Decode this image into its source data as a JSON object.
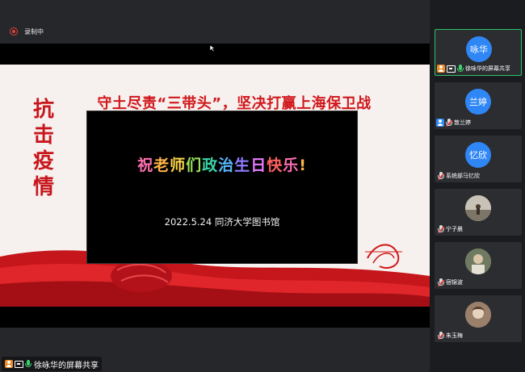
{
  "recording": {
    "label": "录制中"
  },
  "slide": {
    "banner": "守土尽责“三带头”，坚决打赢上海保卫战",
    "vertical_title": [
      "抗",
      "击",
      "疫",
      "情"
    ],
    "inner_screen": {
      "greeting_chars": [
        "祝",
        "老",
        "师",
        "们",
        "政",
        "治",
        "生",
        "日",
        "快",
        "乐",
        "!"
      ],
      "caption": "2022.5.24  同济大学图书馆"
    }
  },
  "share_tag": {
    "label": "徐咏华的屏幕共享"
  },
  "participants": [
    {
      "avatar_text": "咏华",
      "name": "徐咏华的屏幕共享",
      "role": "host",
      "sharing": true,
      "mic": "on",
      "photo": false
    },
    {
      "avatar_text": "兰婷",
      "name": "敦兰婷",
      "role": "cohost",
      "sharing": false,
      "mic": "muted",
      "photo": false
    },
    {
      "avatar_text": "忆欣",
      "name": "系统部马忆欣",
      "role": "",
      "sharing": false,
      "mic": "muted",
      "photo": false
    },
    {
      "avatar_text": "",
      "name": "宁子晨",
      "role": "",
      "sharing": false,
      "mic": "muted",
      "photo": true
    },
    {
      "avatar_text": "",
      "name": "宿锦波",
      "role": "",
      "sharing": false,
      "mic": "muted",
      "photo": true
    },
    {
      "avatar_text": "",
      "name": "朱玉梅",
      "role": "",
      "sharing": false,
      "mic": "muted",
      "photo": true
    }
  ],
  "colors": {
    "accent_red": "#d1161b",
    "active_border": "#2cc36b",
    "avatar_blue": "#2f86f5",
    "host_orange": "#f08a24"
  }
}
